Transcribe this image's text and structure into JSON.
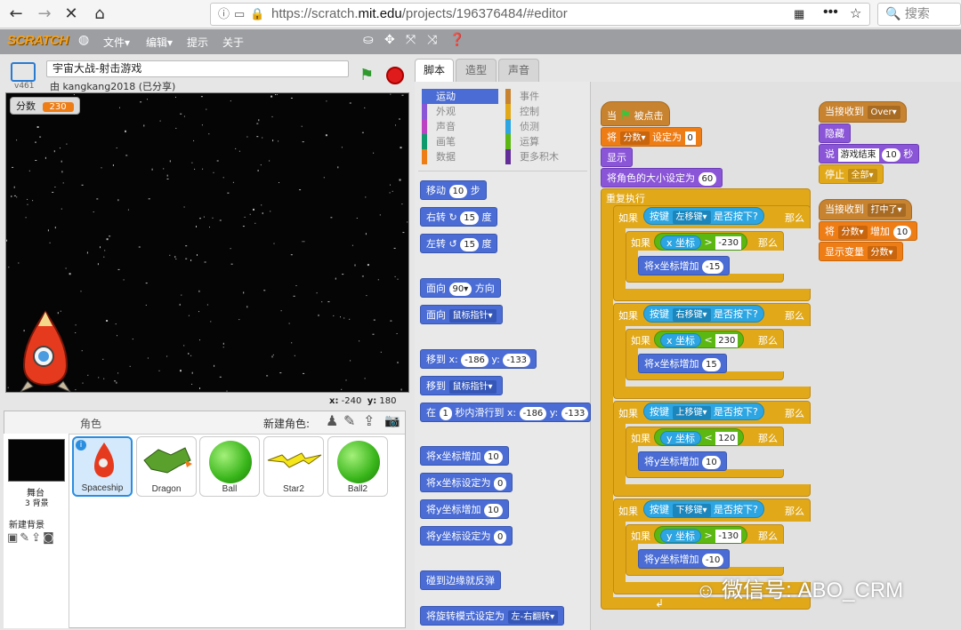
{
  "browser": {
    "url": "https://scratch.mit.edu/projects/196376484/#editor",
    "url_prefix": "https://scratch.",
    "url_host": "mit.edu",
    "url_path": "/projects/196376484/#editor",
    "search_placeholder": "搜索"
  },
  "menu": {
    "logo": "SCRATCH",
    "items": [
      "文件▾",
      "编辑▾",
      "提示",
      "关于"
    ]
  },
  "project": {
    "title": "宇宙大战-射击游戏",
    "author": "由 kangkang2018 (已分享)",
    "version": "v461"
  },
  "stage": {
    "score_label": "分数",
    "score_value": "230",
    "x_label": "x:",
    "x_value": "-240",
    "y_label": "y:",
    "y_value": "180"
  },
  "sprites_panel": {
    "title": "角色",
    "new_sprite_label": "新建角色:",
    "stage_label": "舞台",
    "stage_backdrops": "3 背景",
    "new_backdrop_label": "新建背景",
    "sprites": [
      "Spaceship",
      "Dragon",
      "Ball",
      "Star2",
      "Ball2"
    ]
  },
  "tabs": [
    "脚本",
    "造型",
    "声音"
  ],
  "categories": {
    "left": [
      "运动",
      "外观",
      "声音",
      "画笔",
      "数据"
    ],
    "right": [
      "事件",
      "控制",
      "侦测",
      "运算",
      "更多积木"
    ],
    "left_colors": [
      "#4a6cd4",
      "#8a55d7",
      "#bb42c3",
      "#0e9a6c",
      "#ee7d16"
    ],
    "right_colors": [
      "#c88330",
      "#e1a91a",
      "#2ca5e2",
      "#5cb712",
      "#632d99"
    ]
  },
  "palette": {
    "move": "移动",
    "move_n": "10",
    "steps": "步",
    "turn_right": "右转",
    "turn_left": "左转",
    "deg_n": "15",
    "deg": "度",
    "point_dir": "面向",
    "dir_n": "90▾",
    "dir_suffix": "方向",
    "point_toward": "面向",
    "mouse_ptr": "鼠标指针",
    "goto": "移到",
    "x": "x:",
    "y": "y:",
    "gx": "-186",
    "gy": "-133",
    "goto2": "移到",
    "in": "在",
    "glide_n": "1",
    "glide": "秒内滑行到",
    "chx": "将x坐标增加",
    "setx": "将x坐标设定为",
    "chy": "将y坐标增加",
    "sety": "将y坐标设定为",
    "ten": "10",
    "zero": "0",
    "bounce": "碰到边缘就反弹",
    "rot": "将旋转模式设定为",
    "rot_val": "左-右翻转"
  },
  "script": {
    "when": "当",
    "clicked": "被点击",
    "set": "将",
    "var_score": "分数",
    "set_to": "设定为",
    "set_val": "0",
    "show": "显示",
    "size": "将角色的大小设定为",
    "size_val": "60",
    "forever": "重复执行",
    "if": "如果",
    "then": "那么",
    "key": "按键",
    "pressed": "是否按下?",
    "k_left": "左移键",
    "k_right": "右移键",
    "k_up": "上移键",
    "k_down": "下移键",
    "xpos": "x 坐标",
    "ypos": "y 坐标",
    "gt": ">",
    "lt": "<",
    "c1": "-230",
    "c2": "230",
    "c3": "120",
    "c4": "-130",
    "chx": "将x坐标增加",
    "chy": "将y坐标增加",
    "d1": "-15",
    "d2": "15",
    "d3": "10",
    "d4": "-10"
  },
  "script2": {
    "receive": "当接收到",
    "msg1": "Over",
    "hide": "隐藏",
    "say": "说",
    "say_text": "游戏结束",
    "say_secs": "10",
    "secs": "秒",
    "stop": "停止",
    "stop_val": "全部",
    "msg2": "打中了",
    "change": "将",
    "var": "分数",
    "inc": "增加",
    "inc_val": "10",
    "show_var": "显示变量",
    "show_var_val": "分数"
  },
  "watermark": "微信号: ABO_CRM"
}
